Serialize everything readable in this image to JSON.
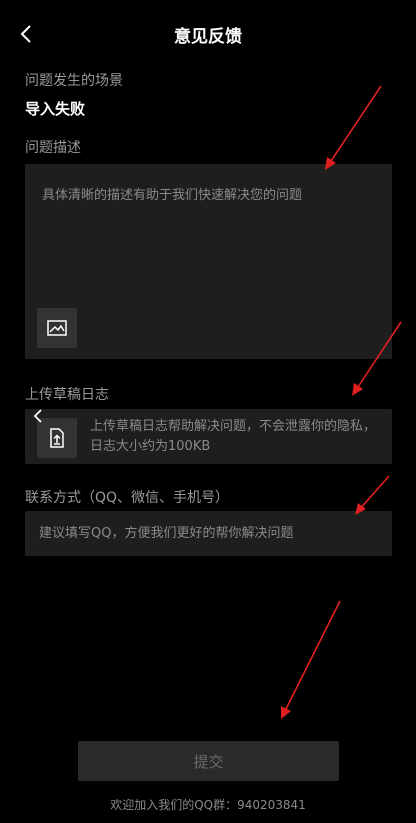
{
  "header": {
    "title": "意见反馈",
    "back_icon": "chevron-left-icon"
  },
  "scene": {
    "label": "问题发生的场景",
    "value": "导入失败"
  },
  "description": {
    "label": "问题描述",
    "placeholder": "具体清晰的描述有助于我们快速解决您的问题",
    "image_icon": "image-icon"
  },
  "log": {
    "label": "上传草稿日志",
    "text": "上传草稿日志帮助解决问题，不会泄露你的隐私，日志大小约为100KB",
    "upload_icon": "upload-icon"
  },
  "contact": {
    "label": "联系方式（QQ、微信、手机号）",
    "placeholder": "建议填写QQ，方便我们更好的帮你解决问题",
    "value": ""
  },
  "submit": {
    "label": "提交"
  },
  "footer": {
    "qq_group": "欢迎加入我们的QQ群：940203841"
  },
  "colors": {
    "background": "#000000",
    "input_bg": "#1e1e1e",
    "annotation_arrow": "#e02020"
  }
}
